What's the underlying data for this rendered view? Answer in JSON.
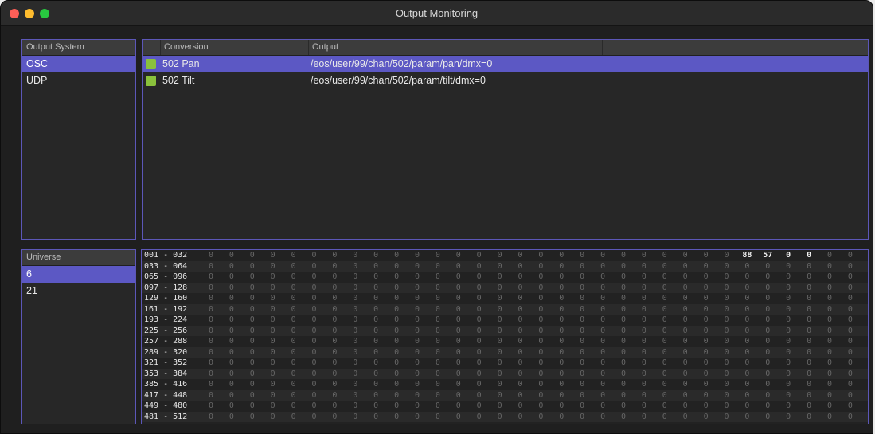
{
  "window": {
    "title": "Output Monitoring"
  },
  "output_system": {
    "header": "Output System",
    "items": [
      {
        "label": "OSC",
        "selected": true
      },
      {
        "label": "UDP",
        "selected": false
      }
    ]
  },
  "conversions": {
    "columns": [
      "Conversion",
      "Output"
    ],
    "rows": [
      {
        "name": "502 Pan",
        "output": "/eos/user/99/chan/502/param/pan/dmx=0",
        "selected": true,
        "color": "#8ac13c"
      },
      {
        "name": "502 Tilt",
        "output": "/eos/user/99/chan/502/param/tilt/dmx=0",
        "selected": false,
        "color": "#8ac13c"
      }
    ]
  },
  "universe": {
    "header": "Universe",
    "items": [
      {
        "label": "6",
        "selected": true
      },
      {
        "label": "21",
        "selected": false
      }
    ]
  },
  "dmx": {
    "rows": [
      {
        "range": "001 - 032",
        "values": [
          0,
          0,
          0,
          0,
          0,
          0,
          0,
          0,
          0,
          0,
          0,
          0,
          0,
          0,
          0,
          0,
          0,
          0,
          0,
          0,
          0,
          0,
          0,
          0,
          0,
          0,
          88,
          57,
          0,
          0,
          0,
          0
        ],
        "highlight": [
          26,
          27,
          28,
          29
        ]
      },
      {
        "range": "033 - 064",
        "values": [
          0,
          0,
          0,
          0,
          0,
          0,
          0,
          0,
          0,
          0,
          0,
          0,
          0,
          0,
          0,
          0,
          0,
          0,
          0,
          0,
          0,
          0,
          0,
          0,
          0,
          0,
          0,
          0,
          0,
          0,
          0,
          0
        ]
      },
      {
        "range": "065 - 096",
        "values": [
          0,
          0,
          0,
          0,
          0,
          0,
          0,
          0,
          0,
          0,
          0,
          0,
          0,
          0,
          0,
          0,
          0,
          0,
          0,
          0,
          0,
          0,
          0,
          0,
          0,
          0,
          0,
          0,
          0,
          0,
          0,
          0
        ]
      },
      {
        "range": "097 - 128",
        "values": [
          0,
          0,
          0,
          0,
          0,
          0,
          0,
          0,
          0,
          0,
          0,
          0,
          0,
          0,
          0,
          0,
          0,
          0,
          0,
          0,
          0,
          0,
          0,
          0,
          0,
          0,
          0,
          0,
          0,
          0,
          0,
          0
        ]
      },
      {
        "range": "129 - 160",
        "values": [
          0,
          0,
          0,
          0,
          0,
          0,
          0,
          0,
          0,
          0,
          0,
          0,
          0,
          0,
          0,
          0,
          0,
          0,
          0,
          0,
          0,
          0,
          0,
          0,
          0,
          0,
          0,
          0,
          0,
          0,
          0,
          0
        ]
      },
      {
        "range": "161 - 192",
        "values": [
          0,
          0,
          0,
          0,
          0,
          0,
          0,
          0,
          0,
          0,
          0,
          0,
          0,
          0,
          0,
          0,
          0,
          0,
          0,
          0,
          0,
          0,
          0,
          0,
          0,
          0,
          0,
          0,
          0,
          0,
          0,
          0
        ]
      },
      {
        "range": "193 - 224",
        "values": [
          0,
          0,
          0,
          0,
          0,
          0,
          0,
          0,
          0,
          0,
          0,
          0,
          0,
          0,
          0,
          0,
          0,
          0,
          0,
          0,
          0,
          0,
          0,
          0,
          0,
          0,
          0,
          0,
          0,
          0,
          0,
          0
        ]
      },
      {
        "range": "225 - 256",
        "values": [
          0,
          0,
          0,
          0,
          0,
          0,
          0,
          0,
          0,
          0,
          0,
          0,
          0,
          0,
          0,
          0,
          0,
          0,
          0,
          0,
          0,
          0,
          0,
          0,
          0,
          0,
          0,
          0,
          0,
          0,
          0,
          0
        ]
      },
      {
        "range": "257 - 288",
        "values": [
          0,
          0,
          0,
          0,
          0,
          0,
          0,
          0,
          0,
          0,
          0,
          0,
          0,
          0,
          0,
          0,
          0,
          0,
          0,
          0,
          0,
          0,
          0,
          0,
          0,
          0,
          0,
          0,
          0,
          0,
          0,
          0
        ]
      },
      {
        "range": "289 - 320",
        "values": [
          0,
          0,
          0,
          0,
          0,
          0,
          0,
          0,
          0,
          0,
          0,
          0,
          0,
          0,
          0,
          0,
          0,
          0,
          0,
          0,
          0,
          0,
          0,
          0,
          0,
          0,
          0,
          0,
          0,
          0,
          0,
          0
        ]
      },
      {
        "range": "321 - 352",
        "values": [
          0,
          0,
          0,
          0,
          0,
          0,
          0,
          0,
          0,
          0,
          0,
          0,
          0,
          0,
          0,
          0,
          0,
          0,
          0,
          0,
          0,
          0,
          0,
          0,
          0,
          0,
          0,
          0,
          0,
          0,
          0,
          0
        ]
      },
      {
        "range": "353 - 384",
        "values": [
          0,
          0,
          0,
          0,
          0,
          0,
          0,
          0,
          0,
          0,
          0,
          0,
          0,
          0,
          0,
          0,
          0,
          0,
          0,
          0,
          0,
          0,
          0,
          0,
          0,
          0,
          0,
          0,
          0,
          0,
          0,
          0
        ]
      },
      {
        "range": "385 - 416",
        "values": [
          0,
          0,
          0,
          0,
          0,
          0,
          0,
          0,
          0,
          0,
          0,
          0,
          0,
          0,
          0,
          0,
          0,
          0,
          0,
          0,
          0,
          0,
          0,
          0,
          0,
          0,
          0,
          0,
          0,
          0,
          0,
          0
        ]
      },
      {
        "range": "417 - 448",
        "values": [
          0,
          0,
          0,
          0,
          0,
          0,
          0,
          0,
          0,
          0,
          0,
          0,
          0,
          0,
          0,
          0,
          0,
          0,
          0,
          0,
          0,
          0,
          0,
          0,
          0,
          0,
          0,
          0,
          0,
          0,
          0,
          0
        ]
      },
      {
        "range": "449 - 480",
        "values": [
          0,
          0,
          0,
          0,
          0,
          0,
          0,
          0,
          0,
          0,
          0,
          0,
          0,
          0,
          0,
          0,
          0,
          0,
          0,
          0,
          0,
          0,
          0,
          0,
          0,
          0,
          0,
          0,
          0,
          0,
          0,
          0
        ]
      },
      {
        "range": "481 - 512",
        "values": [
          0,
          0,
          0,
          0,
          0,
          0,
          0,
          0,
          0,
          0,
          0,
          0,
          0,
          0,
          0,
          0,
          0,
          0,
          0,
          0,
          0,
          0,
          0,
          0,
          0,
          0,
          0,
          0,
          0,
          0,
          0,
          0
        ]
      }
    ]
  },
  "colors": {
    "accent": "#5c58c4",
    "panel_border": "#5c57b8",
    "conversion_swatch": "#8ac13c"
  }
}
